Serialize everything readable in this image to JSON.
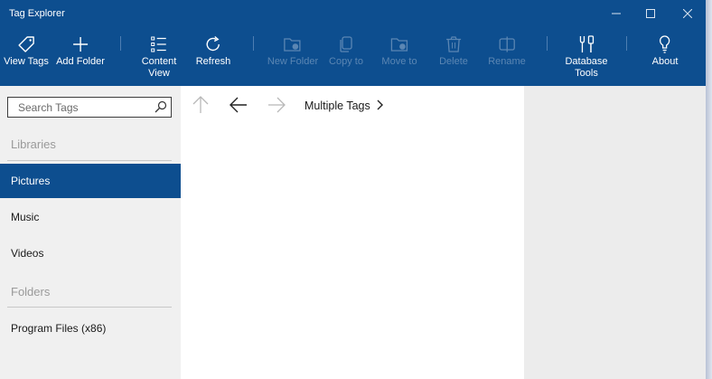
{
  "window": {
    "title": "Tag Explorer"
  },
  "toolbar": {
    "view_tags": "View Tags",
    "add_folder": "Add Folder",
    "content_view_1": "Content",
    "content_view_2": "View",
    "refresh": "Refresh",
    "new_folder": "New Folder",
    "copy_to": "Copy to",
    "move_to": "Move to",
    "delete": "Delete",
    "rename": "Rename",
    "database_tools_1": "Database",
    "database_tools_2": "Tools",
    "about": "About"
  },
  "search": {
    "placeholder": "Search Tags"
  },
  "sidebar": {
    "libraries_header": "Libraries",
    "libraries": [
      {
        "label": "Pictures",
        "selected": true
      },
      {
        "label": "Music",
        "selected": false
      },
      {
        "label": "Videos",
        "selected": false
      }
    ],
    "folders_header": "Folders",
    "folders": [
      {
        "label": "Program Files (x86)"
      }
    ]
  },
  "breadcrumb": {
    "label": "Multiple Tags"
  },
  "colors": {
    "accent": "#0d4e8f",
    "disabled_text": "#5b86b3",
    "sidebar_bg": "#f0f0f0",
    "content_bg": "#ffffff",
    "detail_bg": "#ececec"
  },
  "icons": [
    "tag-icon",
    "plus-icon",
    "list-view-icon",
    "refresh-icon",
    "new-folder-icon",
    "copy-icon",
    "move-folder-icon",
    "delete-icon",
    "rename-icon",
    "database-tools-icon",
    "about-icon",
    "search-icon",
    "up-arrow-icon",
    "back-arrow-icon",
    "forward-arrow-icon",
    "chevron-right-icon"
  ]
}
